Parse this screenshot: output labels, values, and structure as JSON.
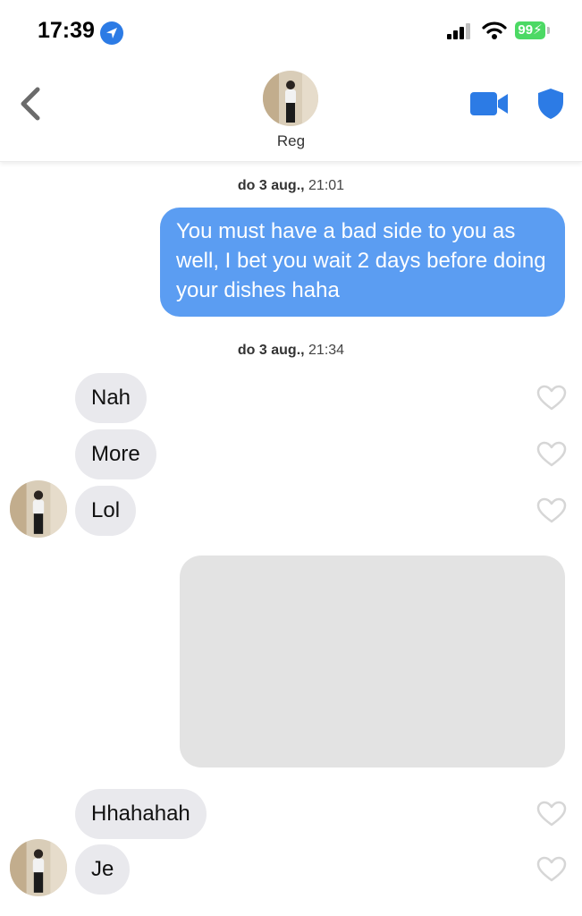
{
  "status_bar": {
    "time": "17:39",
    "battery": "99",
    "icons": [
      "location-arrow-icon",
      "cellular-signal-icon",
      "wifi-icon",
      "battery-charging-icon"
    ]
  },
  "header": {
    "contact_name": "Reg",
    "icons": [
      "chevron-left-icon",
      "video-call-icon",
      "shield-icon"
    ],
    "accent_color": "#2c7be5"
  },
  "messages": {
    "timestamp_1": {
      "day": "do 3 aug.,",
      "time": "21:01"
    },
    "outgoing_1": "You must have a bad side to you as well, I bet you wait 2 days before doing your dishes haha",
    "timestamp_2": {
      "day": "do 3 aug.,",
      "time": "21:34"
    },
    "incoming_1": "Nah",
    "incoming_2": "More",
    "incoming_3": "Lol",
    "incoming_4": "Hhahahah",
    "incoming_5": "Je"
  },
  "colors": {
    "outgoing_bubble": "#5b9df2",
    "incoming_bubble": "#e9e9ed",
    "battery": "#4cd964"
  }
}
